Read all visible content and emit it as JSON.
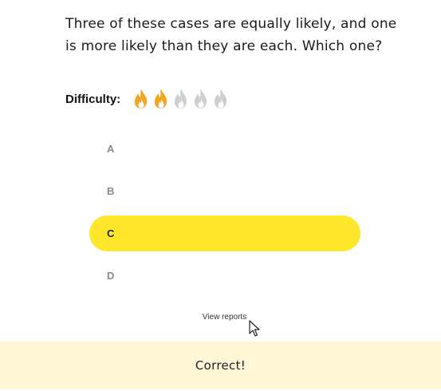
{
  "question": {
    "line1": "Three of these cases are equally likely, and one",
    "line2": "is more likely than they are each. Which one?"
  },
  "difficulty": {
    "label": "Difficulty:",
    "level": 2,
    "max": 5,
    "icon": "flame-icon",
    "active_color": "#f2a423",
    "inactive_color": "#cfcfcf"
  },
  "options": [
    {
      "label": "A",
      "selected": false
    },
    {
      "label": "B",
      "selected": false
    },
    {
      "label": "C",
      "selected": true
    },
    {
      "label": "D",
      "selected": false
    }
  ],
  "view_reports": "View reports",
  "result": {
    "text": "Correct!",
    "background": "#fff7d8"
  },
  "colors": {
    "selected_option": "#ffe72b"
  }
}
